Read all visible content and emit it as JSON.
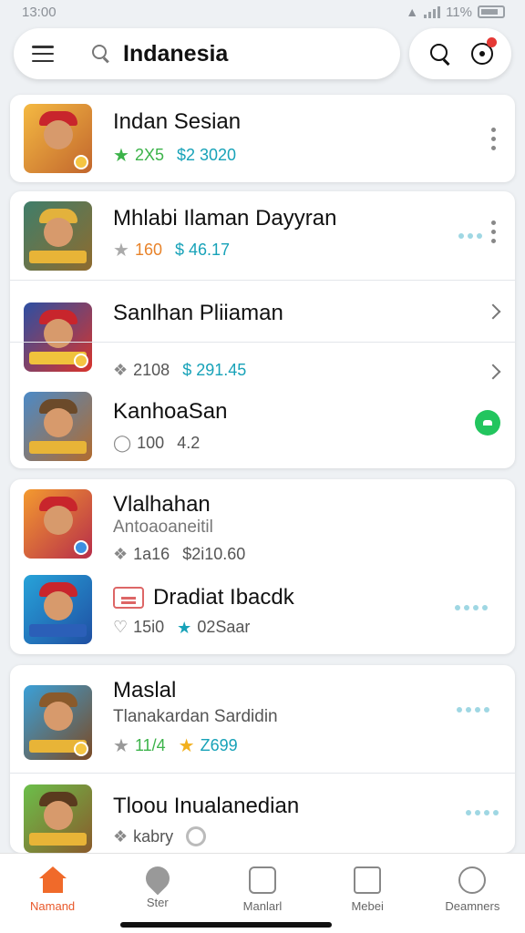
{
  "status_bar": {
    "time": "13:00",
    "battery": "11%"
  },
  "header": {
    "search_text": "Indanesia"
  },
  "colors": {
    "accent": "#f06a2a",
    "green": "#22c55e",
    "teal": "#17a2b8",
    "badge_red": "#e53935"
  },
  "cards": [
    {
      "rows": [
        {
          "title": "Indan Sesian",
          "rating": "2X5",
          "price": "$2 3020",
          "rating_icon": "green-star",
          "trailing": "kebab"
        }
      ]
    },
    {
      "rows": [
        {
          "title": "Mhlabi Ilaman Dayyran",
          "rating": "160",
          "price": "$ 46.17",
          "rating_icon": "gray-star",
          "trailing": "kebab"
        },
        {
          "title": "Sanlhan Pliiaman",
          "trailing": "chevron"
        },
        {
          "rating": "2108",
          "price": "$ 291.45",
          "trailing": "chevron"
        },
        {
          "title": "KanhoaSan",
          "rating": "100",
          "price": "4.2",
          "trailing": "green-toggle"
        }
      ]
    },
    {
      "rows": [
        {
          "title": "Vlalhahan",
          "subtitle": "Antoaoaneitil",
          "rating": "1a16",
          "price": "$2i10.60"
        },
        {
          "title": "Dradiat Ibacdk",
          "rating": "15i0",
          "price": "02Saar"
        }
      ]
    },
    {
      "rows": [
        {
          "title": "Maslal",
          "subtitle": "Tlanakardan Sardidin",
          "rating": "11/4",
          "price": "Z699"
        },
        {
          "title": "Tloou Inualanedian",
          "rating": "kabry"
        }
      ]
    }
  ],
  "bottom_nav": [
    {
      "label": "Namand",
      "icon": "home-icon",
      "active": true
    },
    {
      "label": "Ster",
      "icon": "leaf-icon",
      "active": false
    },
    {
      "label": "Manlarl",
      "icon": "book-icon",
      "active": false
    },
    {
      "label": "Mebei",
      "icon": "house-outline-icon",
      "active": false
    },
    {
      "label": "Deamners",
      "icon": "user-icon",
      "active": false
    }
  ]
}
